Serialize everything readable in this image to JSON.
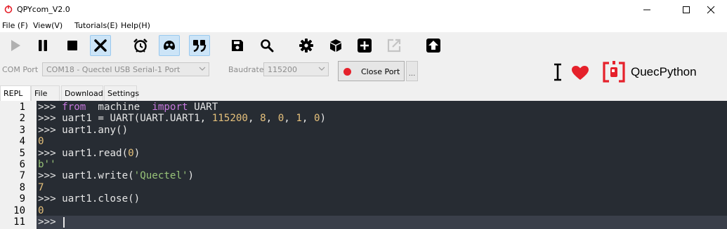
{
  "window": {
    "title": "QPYcom_V2.0"
  },
  "menu": [
    {
      "label": "File (F)"
    },
    {
      "label": "View(V)"
    },
    {
      "label": "Tutorials(E)"
    },
    {
      "label": "Help(H)"
    }
  ],
  "toolbar": {
    "buttons": [
      "play-icon",
      "pause-icon",
      "stop-icon",
      "close-x-icon",
      "alarm-clock-icon",
      "mask-icon",
      "quote-icon",
      "save-icon",
      "search-icon",
      "gear-icon",
      "cube-icon",
      "add-icon",
      "export-icon",
      "upload-icon"
    ],
    "active": [
      "close-x-icon",
      "mask-icon",
      "quote-icon"
    ]
  },
  "port": {
    "com_label": "COM Port",
    "com_value": "COM18 - Quectel USB Serial-1 Port",
    "baud_label": "Baudrate",
    "baud_value": "115200",
    "close_label": "Close Port",
    "more_label": "..."
  },
  "brand": {
    "name": "QuecPython",
    "accent": "#e5212b"
  },
  "tabs": [
    {
      "label": "REPL",
      "active": true
    },
    {
      "label": "File",
      "active": false
    },
    {
      "label": "Download",
      "active": false
    },
    {
      "label": "Settings",
      "active": false
    }
  ],
  "repl": {
    "line_numbers": [
      "1",
      "2",
      "3",
      "4",
      "5",
      "6",
      "7",
      "8",
      "9",
      "10",
      "11"
    ],
    "lines": [
      {
        "prompt": ">>> ",
        "parts": [
          [
            "kw",
            "from"
          ],
          [
            "",
            "  machine  "
          ],
          [
            "kw",
            "import"
          ],
          [
            "",
            " UART"
          ]
        ]
      },
      {
        "prompt": ">>> ",
        "parts": [
          [
            "",
            "uart1 = UART(UART.UART1, "
          ],
          [
            "num",
            "115200"
          ],
          [
            "",
            ", "
          ],
          [
            "num",
            "8"
          ],
          [
            "",
            ", "
          ],
          [
            "num",
            "0"
          ],
          [
            "",
            ", "
          ],
          [
            "num",
            "1"
          ],
          [
            "",
            ", "
          ],
          [
            "num",
            "0"
          ],
          [
            "",
            ")"
          ]
        ]
      },
      {
        "prompt": ">>> ",
        "parts": [
          [
            "",
            "uart1.any()"
          ]
        ]
      },
      {
        "prompt": "",
        "parts": [
          [
            "out",
            "0"
          ]
        ]
      },
      {
        "prompt": ">>> ",
        "parts": [
          [
            "",
            "uart1.read("
          ],
          [
            "num",
            "0"
          ],
          [
            "",
            ")"
          ]
        ]
      },
      {
        "prompt": "",
        "parts": [
          [
            "strout",
            "b''"
          ]
        ]
      },
      {
        "prompt": ">>> ",
        "parts": [
          [
            "",
            "uart1.write("
          ],
          [
            "str",
            "'Quectel'"
          ],
          [
            "",
            ")"
          ]
        ]
      },
      {
        "prompt": "",
        "parts": [
          [
            "out",
            "7"
          ]
        ]
      },
      {
        "prompt": ">>> ",
        "parts": [
          [
            "",
            "uart1.close()"
          ]
        ]
      },
      {
        "prompt": "",
        "parts": [
          [
            "out",
            "0"
          ]
        ]
      },
      {
        "prompt": ">>> ",
        "parts": []
      }
    ]
  }
}
